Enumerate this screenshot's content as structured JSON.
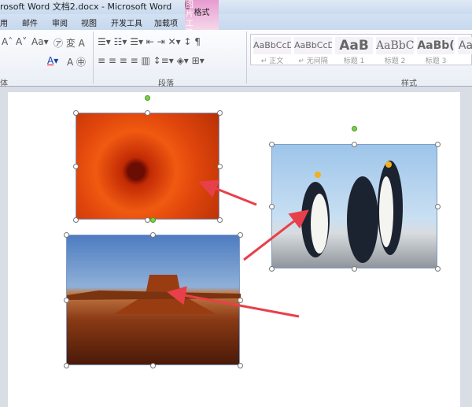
{
  "window": {
    "title": "rosoft Word 文档2.docx  -  Microsoft Word"
  },
  "tabs": [
    "用",
    "邮件",
    "审阅",
    "视图",
    "开发工具",
    "加载项"
  ],
  "picture_tools": {
    "header": "图片工具",
    "tab": "格式"
  },
  "ribbon": {
    "font_group": "体",
    "paragraph_group": "段落",
    "styles_group": "样式"
  },
  "styles": [
    {
      "sample": "AaBbCcD",
      "name": "↵ 正文"
    },
    {
      "sample": "AaBbCcD",
      "name": "↵ 无间隔"
    },
    {
      "sample": "AaB",
      "name": "标题 1"
    },
    {
      "sample": "AaBbC",
      "name": "标题 2"
    },
    {
      "sample": "AaBb(",
      "name": "标题 3"
    },
    {
      "sample": "Aa",
      "name": ""
    }
  ],
  "images": [
    {
      "subject": "orange flower"
    },
    {
      "subject": "penguins"
    },
    {
      "subject": "desert butte"
    }
  ],
  "arrow_color": "#e8404a"
}
